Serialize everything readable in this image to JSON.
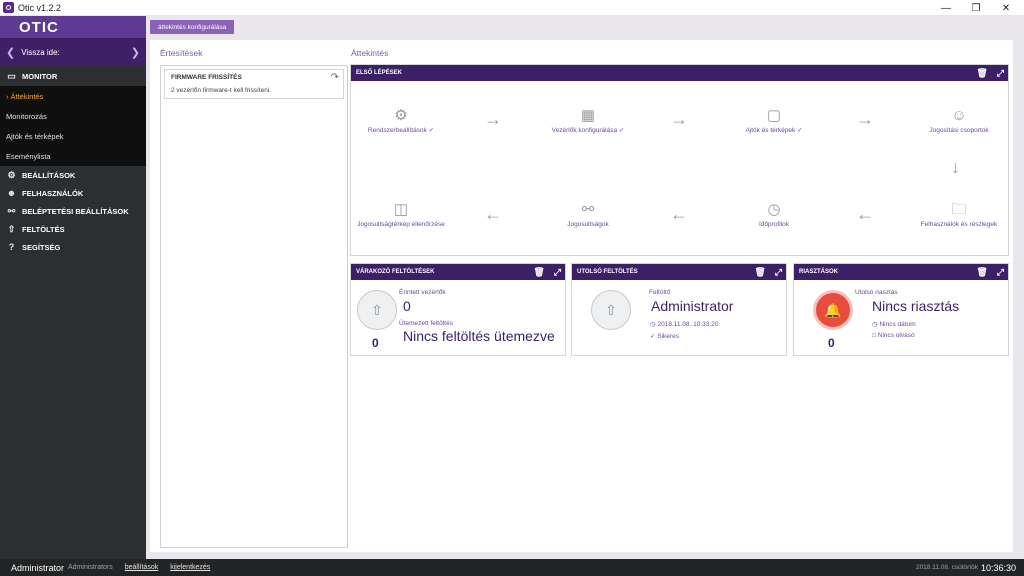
{
  "window": {
    "title": "Otic v1.2.2",
    "minimize": "—",
    "maximize": "❐",
    "close": "✕"
  },
  "sidebar": {
    "logo": "OTIC",
    "back_label": "Vissza ide:",
    "monitor_label": "MONITOR",
    "monitor_items": [
      {
        "label": "Áttekintés",
        "current": true
      },
      {
        "label": "Monitorozás"
      },
      {
        "label": "Ajtók és térképek"
      },
      {
        "label": "Eseménylista"
      }
    ],
    "sections": [
      {
        "label": "BEÁLLÍTÁSOK",
        "icon": "gear-icon"
      },
      {
        "label": "FELHASZNÁLÓK",
        "icon": "users-icon"
      },
      {
        "label": "BELÉPTETÉSI BEÁLLÍTÁSOK",
        "icon": "key-icon"
      },
      {
        "label": "FELTÖLTÉS",
        "icon": "upload-icon"
      },
      {
        "label": "SEGÍTSÉG",
        "icon": "help-icon"
      }
    ]
  },
  "toolbar": {
    "config_button": "áttekintés konfigurálása"
  },
  "notifications": {
    "title": "Értesítések",
    "card_title": "FIRMWARE FRISSÍTÉS",
    "card_text": "2 vezérlőn firmware-t kell frissíteni."
  },
  "overview": {
    "title": "Áttekintés",
    "first_steps": {
      "header": "ELSŐ LÉPÉSEK",
      "steps": [
        {
          "label": "Rendszerbeállítások",
          "icon": "gear-icon",
          "done": true
        },
        {
          "label": "Vezérlők konfigurálása",
          "icon": "chip-icon",
          "done": true
        },
        {
          "label": "Ajtók és térképek",
          "icon": "door-icon",
          "done": true
        },
        {
          "label": "Jogosítási csoportok",
          "icon": "group-icon",
          "done": false
        },
        {
          "label": "Felhasználók és részlegek",
          "icon": "folder-icon",
          "done": false
        },
        {
          "label": "Időprofilok",
          "icon": "clock-icon",
          "done": false
        },
        {
          "label": "Jogosultságok",
          "icon": "key-icon",
          "done": false
        },
        {
          "label": "Jogosultságtérkép ellenőrzése",
          "icon": "map-icon",
          "done": false
        }
      ]
    },
    "pending_uploads": {
      "header": "VÁRAKOZÓ FELTÖLTÉSEK",
      "affected_label": "Érintett vezérlők",
      "affected_value": "0",
      "scheduled_label": "Ütemezett feltöltés",
      "scheduled_value": "Nincs feltöltés ütemezve",
      "count": "0"
    },
    "last_upload": {
      "header": "UTOLSÓ FELTÖLTÉS",
      "uploader_label": "Feltöltő",
      "uploader_value": "Administrator",
      "datetime": "2018.11.08. 10:33:20",
      "status": "Sikeres"
    },
    "alarms": {
      "header": "RIASZTÁSOK",
      "last_label": "Utolsó riasztás",
      "last_value": "Nincs riasztás",
      "no_date": "Nincs dátum",
      "no_reader": "Nincs olvasó",
      "count": "0"
    }
  },
  "statusbar": {
    "user": "Administrator",
    "role": "Administrators",
    "settings_link": "beállítások",
    "logout_link": "kijelentkezés",
    "date": "2018.11.08. csütörtök",
    "time": "10:36:30"
  }
}
